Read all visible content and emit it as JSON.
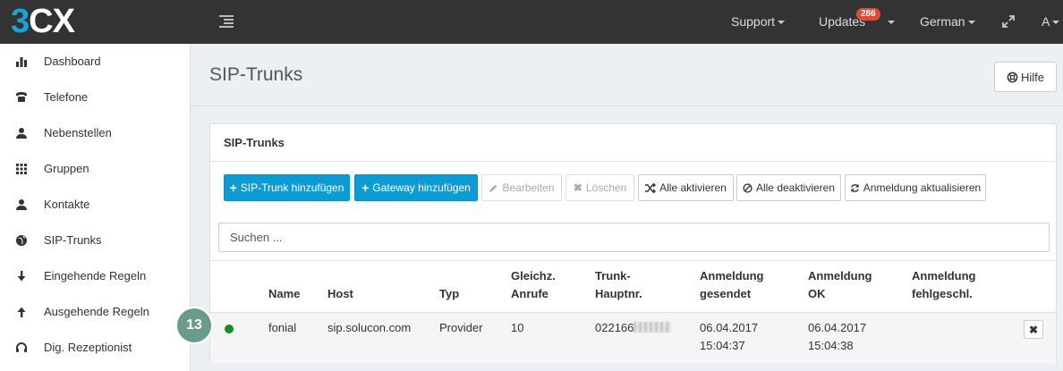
{
  "header": {
    "logo_prefix": "3",
    "logo_suffix": "CX",
    "support_label": "Support",
    "updates_label": "Updates",
    "updates_badge": "286",
    "language_label": "German",
    "user_label": "A"
  },
  "sidebar": {
    "items": [
      {
        "label": "Dashboard",
        "icon": "bar-chart-icon"
      },
      {
        "label": "Telefone",
        "icon": "phone-icon"
      },
      {
        "label": "Nebenstellen",
        "icon": "user-icon"
      },
      {
        "label": "Gruppen",
        "icon": "grid-icon"
      },
      {
        "label": "Kontakte",
        "icon": "user-icon"
      },
      {
        "label": "SIP-Trunks",
        "icon": "globe-icon"
      },
      {
        "label": "Eingehende Regeln",
        "icon": "arrow-down-icon"
      },
      {
        "label": "Ausgehende Regeln",
        "icon": "arrow-up-icon"
      },
      {
        "label": "Dig. Rezeptionist",
        "icon": "headset-icon"
      }
    ]
  },
  "page": {
    "title": "SIP-Trunks",
    "help_label": "Hilfe"
  },
  "panel": {
    "title": "SIP-Trunks",
    "toolbar": {
      "add_trunk": "SIP-Trunk hinzufügen",
      "add_gateway": "Gateway hinzufügen",
      "edit": "Bearbeiten",
      "delete": "Löschen",
      "activate_all": "Alle aktivieren",
      "deactivate_all": "Alle deaktivieren",
      "refresh_registration": "Anmeldung aktualisieren"
    },
    "search_placeholder": "Suchen ..."
  },
  "table": {
    "headers": {
      "name": "Name",
      "host": "Host",
      "type": "Typ",
      "simultaneous_l1": "Gleichz.",
      "simultaneous_l2": "Anrufe",
      "main_number_l1": "Trunk-",
      "main_number_l2": "Hauptnr.",
      "reg_sent_l1": "Anmeldung",
      "reg_sent_l2": "gesendet",
      "reg_ok_l1": "Anmeldung",
      "reg_ok_l2": "OK",
      "reg_failed_l1": "Anmeldung",
      "reg_failed_l2": "fehlgeschl."
    },
    "rows": [
      {
        "status": "online",
        "name": "fonial",
        "host": "sip.solucon.com",
        "type": "Provider",
        "simultaneous_calls": "10",
        "main_number_visible": "022166",
        "reg_sent_date": "06.04.2017",
        "reg_sent_time": "15:04:37",
        "reg_ok_date": "06.04.2017",
        "reg_ok_time": "15:04:38",
        "reg_failed": ""
      }
    ]
  },
  "step_marker": "13",
  "colors": {
    "primary": "#0d9bd3",
    "status_online": "#1e8a1e",
    "badge": "#dd4b39",
    "topbar": "#333333"
  }
}
